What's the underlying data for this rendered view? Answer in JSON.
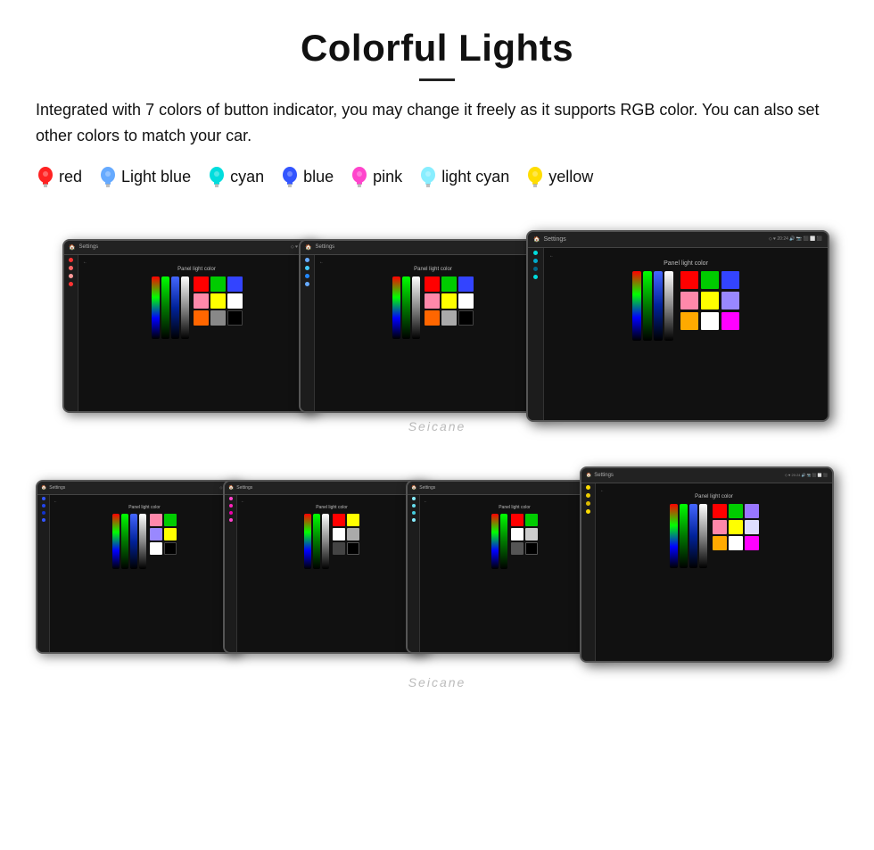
{
  "page": {
    "title": "Colorful Lights",
    "divider": true,
    "description": "Integrated with 7 colors of button indicator, you may change it freely as it supports RGB color. You can also set other colors to match your car.",
    "colors": [
      {
        "name": "red",
        "color": "#ff2222",
        "label": "red"
      },
      {
        "name": "light-blue",
        "color": "#66aaff",
        "label": "Light blue"
      },
      {
        "name": "cyan",
        "color": "#00dddd",
        "label": "cyan"
      },
      {
        "name": "blue",
        "color": "#3355ff",
        "label": "blue"
      },
      {
        "name": "pink",
        "color": "#ff44cc",
        "label": "pink"
      },
      {
        "name": "light-cyan",
        "color": "#88eeff",
        "label": "light cyan"
      },
      {
        "name": "yellow",
        "color": "#ffdd00",
        "label": "yellow"
      }
    ],
    "watermark1": "Seicane",
    "watermark2": "Seicane",
    "screen_label": "Panel light color",
    "settings_label": "Settings"
  }
}
